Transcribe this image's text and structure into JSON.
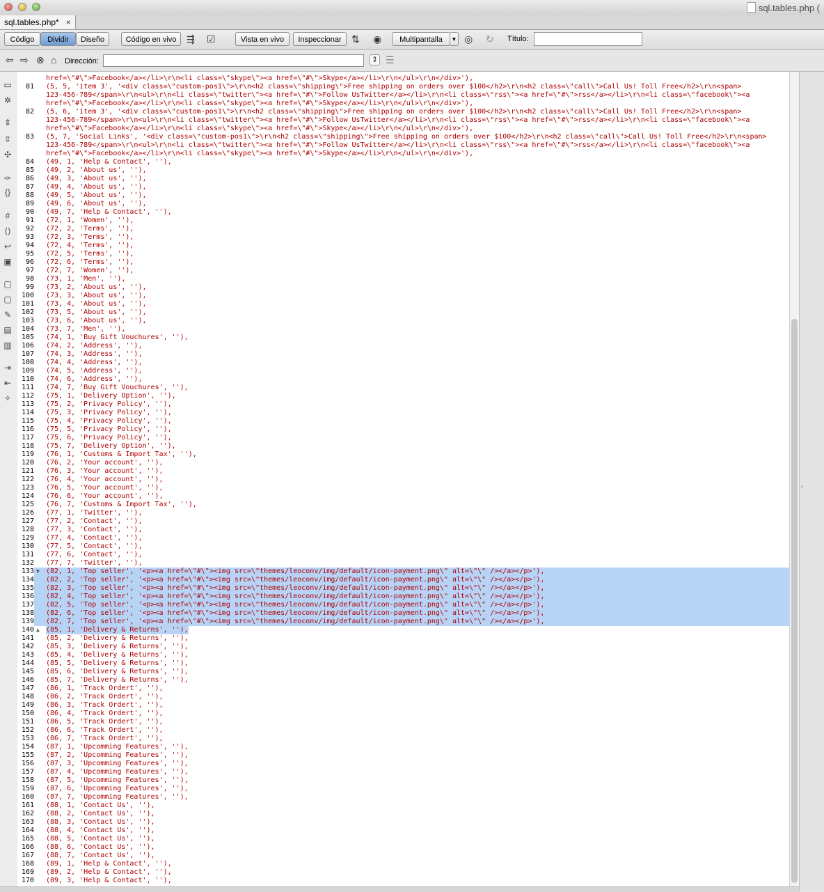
{
  "window": {
    "title": "sql.tables.php ("
  },
  "tabs": [
    {
      "label": "sql.tables.php*",
      "close": "×"
    }
  ],
  "toolbar": {
    "view_buttons": [
      "Código",
      "Dividir",
      "Diseño"
    ],
    "active_view": "Dividir",
    "live_code": "Código en vivo",
    "live_view": "Vista en vivo",
    "inspect": "Inspeccionar",
    "multiscreen": "Multipantalla",
    "title_label": "Título:",
    "title_value": ""
  },
  "address": {
    "label": "Dirección:",
    "value": ""
  },
  "editor": {
    "lines": [
      {
        "n": "",
        "code": "href=\\\"#\\\">Facebook</a></li>\\r\\n<li class=\\\"skype\\\"><a href=\\\"#\\\">Skype</a></li>\\r\\n</ul>\\r\\n</div>'),"
      },
      {
        "n": "81",
        "code": "(5, 5, 'item 3', '<div class=\\\"custom-pos1\\\">\\r\\n<h2 class=\\\"shipping\\\">Free shipping on orders over $100</h2>\\r\\n<h2 class=\\\"call\\\">Call Us! Toll Free</h2>\\r\\n<span>"
      },
      {
        "n": "",
        "code": "123-456-789</span>\\r\\n<ul>\\r\\n<li class=\\\"twitter\\\"><a href=\\\"#\\\">Follow UsTwitter</a></li>\\r\\n<li class=\\\"rss\\\"><a href=\\\"#\\\">rss</a></li>\\r\\n<li class=\\\"facebook\\\"><a"
      },
      {
        "n": "",
        "code": "href=\\\"#\\\">Facebook</a></li>\\r\\n<li class=\\\"skype\\\"><a href=\\\"#\\\">Skype</a></li>\\r\\n</ul>\\r\\n</div>'),"
      },
      {
        "n": "82",
        "code": "(5, 6, 'item 3', '<div class=\\\"custom-pos1\\\">\\r\\n<h2 class=\\\"shipping\\\">Free shipping on orders over $100</h2>\\r\\n<h2 class=\\\"call\\\">Call Us! Toll Free</h2>\\r\\n<span>"
      },
      {
        "n": "",
        "code": "123-456-789</span>\\r\\n<ul>\\r\\n<li class=\\\"twitter\\\"><a href=\\\"#\\\">Follow UsTwitter</a></li>\\r\\n<li class=\\\"rss\\\"><a href=\\\"#\\\">rss</a></li>\\r\\n<li class=\\\"facebook\\\"><a"
      },
      {
        "n": "",
        "code": "href=\\\"#\\\">Facebook</a></li>\\r\\n<li class=\\\"skype\\\"><a href=\\\"#\\\">Skype</a></li>\\r\\n</ul>\\r\\n</div>'),"
      },
      {
        "n": "83",
        "code": "(5, 7, 'Social Links', '<div class=\\\"custom-pos1\\\">\\r\\n<h2 class=\\\"shipping\\\">Free shipping on orders over $100</h2>\\r\\n<h2 class=\\\"call\\\">Call Us! Toll Free</h2>\\r\\n<span>"
      },
      {
        "n": "",
        "code": "123-456-789</span>\\r\\n<ul>\\r\\n<li class=\\\"twitter\\\"><a href=\\\"#\\\">Follow UsTwitter</a></li>\\r\\n<li class=\\\"rss\\\"><a href=\\\"#\\\">rss</a></li>\\r\\n<li class=\\\"facebook\\\"><a"
      },
      {
        "n": "",
        "code": "href=\\\"#\\\">Facebook</a></li>\\r\\n<li class=\\\"skype\\\"><a href=\\\"#\\\">Skype</a></li>\\r\\n</ul>\\r\\n</div>'),"
      },
      {
        "n": "84",
        "code": "(49, 1, 'Help & Contact', ''),"
      },
      {
        "n": "85",
        "code": "(49, 2, 'About us', ''),"
      },
      {
        "n": "86",
        "code": "(49, 3, 'About us', ''),"
      },
      {
        "n": "87",
        "code": "(49, 4, 'About us', ''),"
      },
      {
        "n": "88",
        "code": "(49, 5, 'About us', ''),"
      },
      {
        "n": "89",
        "code": "(49, 6, 'About us', ''),"
      },
      {
        "n": "90",
        "code": "(49, 7, 'Help & Contact', ''),"
      },
      {
        "n": "91",
        "code": "(72, 1, 'Women', ''),"
      },
      {
        "n": "92",
        "code": "(72, 2, 'Terms', ''),"
      },
      {
        "n": "93",
        "code": "(72, 3, 'Terms', ''),"
      },
      {
        "n": "94",
        "code": "(72, 4, 'Terms', ''),"
      },
      {
        "n": "95",
        "code": "(72, 5, 'Terms', ''),"
      },
      {
        "n": "96",
        "code": "(72, 6, 'Terms', ''),"
      },
      {
        "n": "97",
        "code": "(72, 7, 'Women', ''),"
      },
      {
        "n": "98",
        "code": "(73, 1, 'Men', ''),"
      },
      {
        "n": "99",
        "code": "(73, 2, 'About us', ''),"
      },
      {
        "n": "100",
        "code": "(73, 3, 'About us', ''),"
      },
      {
        "n": "101",
        "code": "(73, 4, 'About us', ''),"
      },
      {
        "n": "102",
        "code": "(73, 5, 'About us', ''),"
      },
      {
        "n": "103",
        "code": "(73, 6, 'About us', ''),"
      },
      {
        "n": "104",
        "code": "(73, 7, 'Men', ''),"
      },
      {
        "n": "105",
        "code": "(74, 1, 'Buy Gift Vouchures', ''),"
      },
      {
        "n": "106",
        "code": "(74, 2, 'Address', ''),"
      },
      {
        "n": "107",
        "code": "(74, 3, 'Address', ''),"
      },
      {
        "n": "108",
        "code": "(74, 4, 'Address', ''),"
      },
      {
        "n": "109",
        "code": "(74, 5, 'Address', ''),"
      },
      {
        "n": "110",
        "code": "(74, 6, 'Address', ''),"
      },
      {
        "n": "111",
        "code": "(74, 7, 'Buy Gift Vouchures', ''),"
      },
      {
        "n": "112",
        "code": "(75, 1, 'Delivery Option', ''),"
      },
      {
        "n": "113",
        "code": "(75, 2, 'Privacy Policy', ''),"
      },
      {
        "n": "114",
        "code": "(75, 3, 'Privacy Policy', ''),"
      },
      {
        "n": "115",
        "code": "(75, 4, 'Privacy Policy', ''),"
      },
      {
        "n": "116",
        "code": "(75, 5, 'Privacy Policy', ''),"
      },
      {
        "n": "117",
        "code": "(75, 6, 'Privacy Policy', ''),"
      },
      {
        "n": "118",
        "code": "(75, 7, 'Delivery Option', ''),"
      },
      {
        "n": "119",
        "code": "(76, 1, 'Customs & Import Tax', ''),"
      },
      {
        "n": "120",
        "code": "(76, 2, 'Your account', ''),"
      },
      {
        "n": "121",
        "code": "(76, 3, 'Your account', ''),"
      },
      {
        "n": "122",
        "code": "(76, 4, 'Your account', ''),"
      },
      {
        "n": "123",
        "code": "(76, 5, 'Your account', ''),"
      },
      {
        "n": "124",
        "code": "(76, 6, 'Your account', ''),"
      },
      {
        "n": "125",
        "code": "(76, 7, 'Customs & Import Tax', ''),"
      },
      {
        "n": "126",
        "code": "(77, 1, 'Twitter', ''),"
      },
      {
        "n": "127",
        "code": "(77, 2, 'Contact', ''),"
      },
      {
        "n": "128",
        "code": "(77, 3, 'Contact', ''),"
      },
      {
        "n": "129",
        "code": "(77, 4, 'Contact', ''),"
      },
      {
        "n": "130",
        "code": "(77, 5, 'Contact', ''),"
      },
      {
        "n": "131",
        "code": "(77, 6, 'Contact', ''),"
      },
      {
        "n": "132",
        "code": "(77, 7, 'Twitter', ''),"
      },
      {
        "n": "133",
        "code": "(82, 1, 'Top seller', '<p><a href=\\\"#\\\"><img src=\\\"themes/leoconv/img/default/icon-payment.png\\\" alt=\\\"\\\" /></a></p>'),",
        "sel": true,
        "fold": "▼"
      },
      {
        "n": "134",
        "code": "(82, 2, 'Top seller', '<p><a href=\\\"#\\\"><img src=\\\"themes/leoconv/img/default/icon-payment.png\\\" alt=\\\"\\\" /></a></p>'),",
        "sel": true
      },
      {
        "n": "135",
        "code": "(82, 3, 'Top seller', '<p><a href=\\\"#\\\"><img src=\\\"themes/leoconv/img/default/icon-payment.png\\\" alt=\\\"\\\" /></a></p>'),",
        "sel": true
      },
      {
        "n": "136",
        "code": "(82, 4, 'Top seller', '<p><a href=\\\"#\\\"><img src=\\\"themes/leoconv/img/default/icon-payment.png\\\" alt=\\\"\\\" /></a></p>'),",
        "sel": true
      },
      {
        "n": "137",
        "code": "(82, 5, 'Top seller', '<p><a href=\\\"#\\\"><img src=\\\"themes/leoconv/img/default/icon-payment.png\\\" alt=\\\"\\\" /></a></p>'),",
        "sel": true
      },
      {
        "n": "138",
        "code": "(82, 6, 'Top seller', '<p><a href=\\\"#\\\"><img src=\\\"themes/leoconv/img/default/icon-payment.png\\\" alt=\\\"\\\" /></a></p>'),",
        "sel": true
      },
      {
        "n": "139",
        "code": "(82, 7, 'Top seller', '<p><a href=\\\"#\\\"><img src=\\\"themes/leoconv/img/default/icon-payment.png\\\" alt=\\\"\\\" /></a></p>'),",
        "sel": true
      },
      {
        "n": "140",
        "code": "(85, 1, 'Delivery & Returns', ''),",
        "sel": "partial",
        "fold": "▲"
      },
      {
        "n": "141",
        "code": "(85, 2, 'Delivery & Returns', ''),"
      },
      {
        "n": "142",
        "code": "(85, 3, 'Delivery & Returns', ''),"
      },
      {
        "n": "143",
        "code": "(85, 4, 'Delivery & Returns', ''),"
      },
      {
        "n": "144",
        "code": "(85, 5, 'Delivery & Returns', ''),"
      },
      {
        "n": "145",
        "code": "(85, 6, 'Delivery & Returns', ''),"
      },
      {
        "n": "146",
        "code": "(85, 7, 'Delivery & Returns', ''),"
      },
      {
        "n": "147",
        "code": "(86, 1, 'Track Ordert', ''),"
      },
      {
        "n": "148",
        "code": "(86, 2, 'Track Ordert', ''),"
      },
      {
        "n": "149",
        "code": "(86, 3, 'Track Ordert', ''),"
      },
      {
        "n": "150",
        "code": "(86, 4, 'Track Ordert', ''),"
      },
      {
        "n": "151",
        "code": "(86, 5, 'Track Ordert', ''),"
      },
      {
        "n": "152",
        "code": "(86, 6, 'Track Ordert', ''),"
      },
      {
        "n": "153",
        "code": "(86, 7, 'Track Ordert', ''),"
      },
      {
        "n": "154",
        "code": "(87, 1, 'Upcomming Features', ''),"
      },
      {
        "n": "155",
        "code": "(87, 2, 'Upcomming Features', ''),"
      },
      {
        "n": "156",
        "code": "(87, 3, 'Upcomming Features', ''),"
      },
      {
        "n": "157",
        "code": "(87, 4, 'Upcomming Features', ''),"
      },
      {
        "n": "158",
        "code": "(87, 5, 'Upcomming Features', ''),"
      },
      {
        "n": "159",
        "code": "(87, 6, 'Upcomming Features', ''),"
      },
      {
        "n": "160",
        "code": "(87, 7, 'Upcomming Features', ''),"
      },
      {
        "n": "161",
        "code": "(88, 1, 'Contact Us', ''),"
      },
      {
        "n": "162",
        "code": "(88, 2, 'Contact Us', ''),"
      },
      {
        "n": "163",
        "code": "(88, 3, 'Contact Us', ''),"
      },
      {
        "n": "164",
        "code": "(88, 4, 'Contact Us', ''),"
      },
      {
        "n": "165",
        "code": "(88, 5, 'Contact Us', ''),"
      },
      {
        "n": "166",
        "code": "(88, 6, 'Contact Us', ''),"
      },
      {
        "n": "167",
        "code": "(88, 7, 'Contact Us', ''),"
      },
      {
        "n": "168",
        "code": "(89, 1, 'Help & Contact', ''),"
      },
      {
        "n": "169",
        "code": "(89, 2, 'Help & Contact', ''),"
      },
      {
        "n": "170",
        "code": "(89, 3, 'Help & Contact', ''),"
      }
    ]
  }
}
